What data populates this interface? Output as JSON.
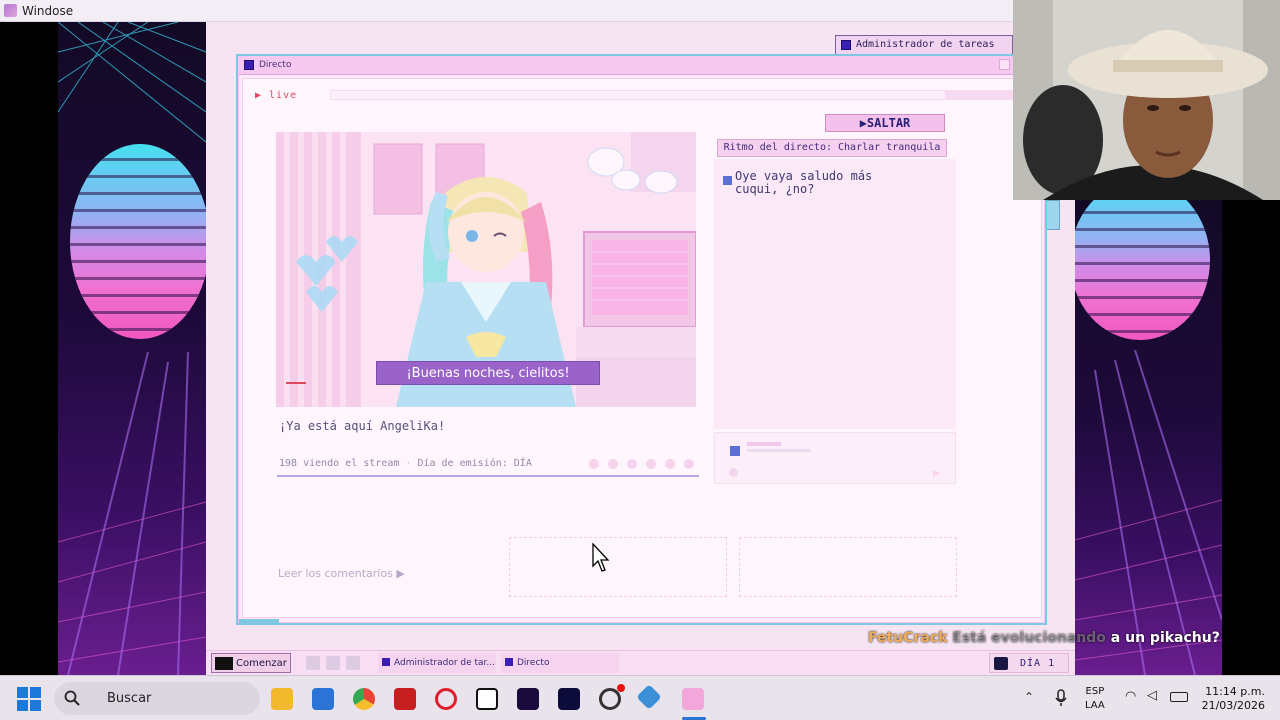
{
  "host": {
    "title": "Windose"
  },
  "background_window": {
    "title": "Administrador de tareas"
  },
  "window": {
    "title": "Directo",
    "live_label": "▶ live",
    "skip_label": "▶SALTAR",
    "subtitle": "¡Buenas noches, cielitos!",
    "arrival_text": "¡Ya está aquí AngeliKa!",
    "viewers_text": "198 viendo el stream",
    "broadcast_day_text": "Día de emisión: DÍA",
    "chat_rhythm": "Ritmo del directo: Charlar tranquila",
    "chat_messages": [
      {
        "text": "Oye vaya saludo más cuqui, ¿no?"
      }
    ],
    "read_comments": "Leer los comentarios ▶"
  },
  "app_taskbar": {
    "start_label": "Comenzar",
    "tasks": [
      "Administrador de tar...",
      "Directo"
    ],
    "day_label": "DÍA 1"
  },
  "overlay_caption": {
    "user": "FetuCrack",
    "text_faded": "Está evolucionando",
    "text_visible": "a un pikachu?"
  },
  "win_taskbar": {
    "search_placeholder": "Buscar",
    "lang_line1": "ESP",
    "lang_line2": "LAA",
    "time": "11:14 p.m.",
    "date": "21/03/2026"
  },
  "colors": {
    "window_border": "#7ec8e3",
    "window_bg": "#fde9fa",
    "accent_purple": "#3b1fb5",
    "live_red": "#e0485f",
    "subtitle_bg": "#9a63c9"
  }
}
